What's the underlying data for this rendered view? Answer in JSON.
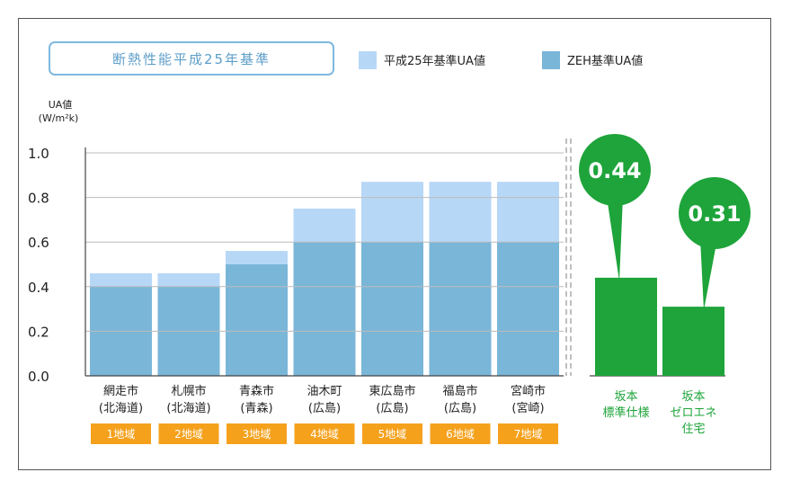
{
  "chart_data": {
    "type": "bar",
    "title": "断熱性能平成25年基準",
    "ylabel_line1": "UA値",
    "ylabel_line2": "(W/m²k)",
    "ylim": [
      0,
      1.0
    ],
    "yticks": [
      "0.0",
      "0.2",
      "0.4",
      "0.6",
      "0.8",
      "1.0"
    ],
    "ytick_values": [
      0,
      0.2,
      0.4,
      0.6,
      0.8,
      1.0
    ],
    "legend": [
      "平成25年基準UA値",
      "ZEH基準UA値"
    ],
    "colors": {
      "h25": "#b7d7f7",
      "zeh": "#7ab6d8",
      "sakamoto": "#1ea43a",
      "region_badge": "#f5a11c",
      "title_border": "#7eb9dd",
      "title_text": "#5e9ec9"
    },
    "categories": [
      {
        "name": "網走市",
        "sub": "(北海道)",
        "region": "1地域"
      },
      {
        "name": "札幌市",
        "sub": "(北海道)",
        "region": "2地域"
      },
      {
        "name": "青森市",
        "sub": "(青森)",
        "region": "3地域"
      },
      {
        "name": "油木町",
        "sub": "(広島)",
        "region": "4地域"
      },
      {
        "name": "東広島市",
        "sub": "(広島)",
        "region": "5地域"
      },
      {
        "name": "福島市",
        "sub": "(広島)",
        "region": "6地域"
      },
      {
        "name": "宮崎市",
        "sub": "(宮崎)",
        "region": "7地域"
      }
    ],
    "series": [
      {
        "name": "平成25年基準UA値",
        "values": [
          0.46,
          0.46,
          0.56,
          0.75,
          0.87,
          0.87,
          0.87
        ]
      },
      {
        "name": "ZEH基準UA値",
        "values": [
          0.4,
          0.4,
          0.5,
          0.6,
          0.6,
          0.6,
          0.6
        ]
      }
    ],
    "sakamoto": [
      {
        "label_lines": [
          "坂本",
          "標準仕様"
        ],
        "value": 0.44,
        "value_label": "0.44"
      },
      {
        "label_lines": [
          "坂本",
          "ゼロエネ",
          "住宅"
        ],
        "value": 0.31,
        "value_label": "0.31"
      }
    ]
  }
}
